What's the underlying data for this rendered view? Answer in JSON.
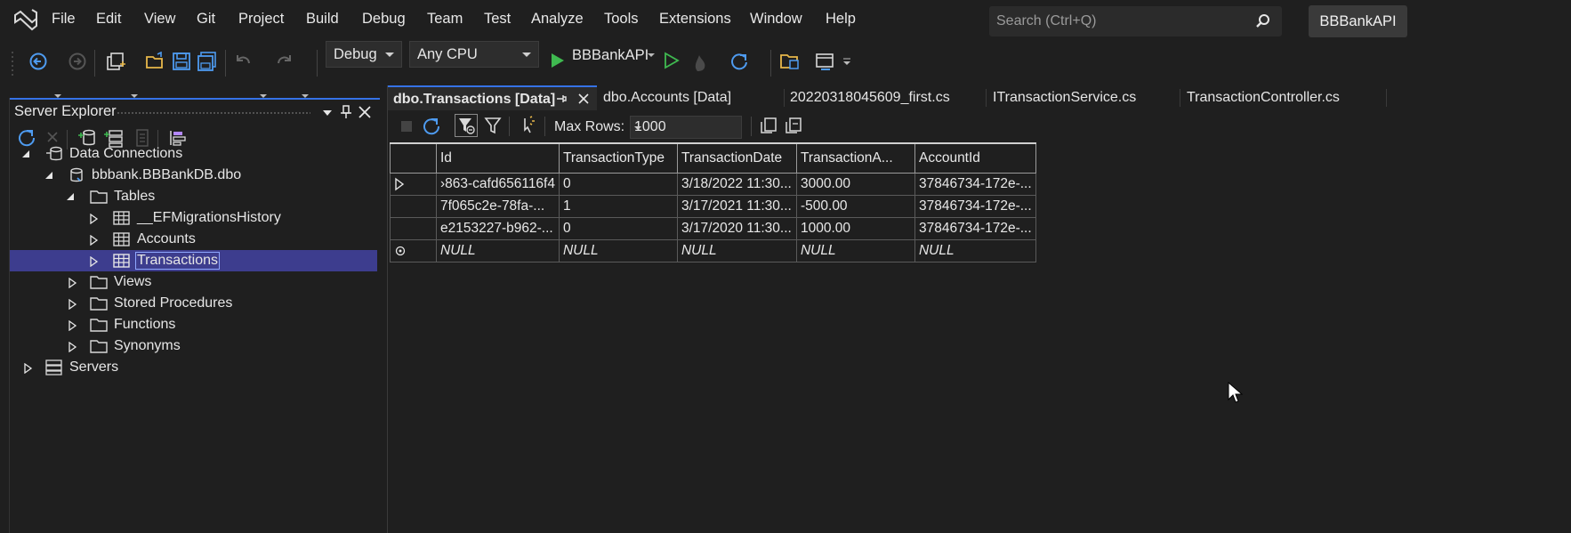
{
  "menubar": {
    "items": [
      "File",
      "Edit",
      "View",
      "Git",
      "Project",
      "Build",
      "Debug",
      "Team",
      "Test",
      "Analyze",
      "Tools",
      "Extensions",
      "Window",
      "Help"
    ],
    "search_placeholder": "Search (Ctrl+Q)",
    "project_name": "BBBankAPI"
  },
  "toolbar": {
    "configuration": "Debug",
    "platform": "Any CPU",
    "start_target": "BBBankAPI"
  },
  "server_explorer": {
    "title": "Server Explorer",
    "tree": {
      "data_connections": "Data Connections",
      "connection": "bbbank.BBBankDB.dbo",
      "tables": "Tables",
      "table_migrations": "__EFMigrationsHistory",
      "table_accounts": "Accounts",
      "table_transactions": "Transactions",
      "views": "Views",
      "stored_procedures": "Stored Procedures",
      "functions": "Functions",
      "synonyms": "Synonyms",
      "servers": "Servers"
    }
  },
  "tabs": [
    "dbo.Transactions [Data]",
    "dbo.Accounts [Data]",
    "20220318045609_first.cs",
    "ITransactionService.cs",
    "TransactionController.cs"
  ],
  "grid": {
    "max_rows_label": "Max Rows:",
    "max_rows_value": "1000",
    "columns": [
      "Id",
      "TransactionType",
      "TransactionDate",
      "TransactionA...",
      "AccountId"
    ],
    "rows": [
      [
        "›863-cafd656116f4",
        "0",
        "3/18/2022 11:30...",
        "3000.00",
        "37846734-172e-..."
      ],
      [
        "7f065c2e-78fa-...",
        "1",
        "3/17/2021 11:30...",
        "-500.00",
        "37846734-172e-..."
      ],
      [
        "e2153227-b962-...",
        "0",
        "3/17/2020 11:30...",
        "1000.00",
        "37846734-172e-..."
      ],
      [
        "NULL",
        "NULL",
        "NULL",
        "NULL",
        "NULL"
      ]
    ]
  },
  "colors": {
    "background": "#1f1f1f",
    "accent": "#3572e6",
    "selection": "#3d3d8e",
    "run_green": "#3fb950",
    "folder_outline": "#d8d8d8"
  }
}
